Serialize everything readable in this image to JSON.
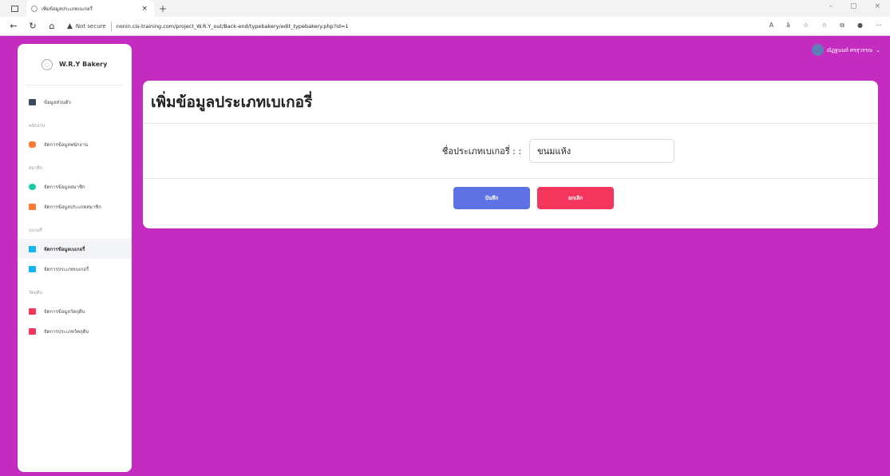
{
  "browser": {
    "tab_title": "เพิ่มข้อมูลประเภทเบเกอรี่",
    "tab_close": "×",
    "new_tab": "+",
    "not_secure": "Not secure",
    "url": "nonin.cis-training.com/project_W.R.Y_out/Back-end/typebakery/edit_typebakery.php?id=1",
    "window_controls": [
      "–",
      "▢",
      "×"
    ]
  },
  "sidebar": {
    "brand": "W.R.Y Bakery",
    "profile_item": "ข้อมูลส่วนตัว",
    "sections": [
      {
        "title": "พนักงาน",
        "items": [
          {
            "label": "จัดการข้อมูลพนักงาน",
            "icon": "user-icon",
            "color": "#ff7a35"
          }
        ]
      },
      {
        "title": "สมาชิก",
        "items": [
          {
            "label": "จัดการข้อมูลสมาชิก",
            "icon": "users-icon",
            "color": "#1bc9a5"
          },
          {
            "label": "จัดการข้อมูลประเภทสมาชิก",
            "icon": "book-icon",
            "color": "#ff7a35"
          }
        ]
      },
      {
        "title": "เบเกอรี่",
        "items": [
          {
            "label": "จัดการข้อมูลเบเกอรี่",
            "icon": "cake-icon",
            "color": "#11b5ef"
          },
          {
            "label": "จัดการประเภทเบเกอรี่",
            "icon": "book-icon",
            "color": "#11b5ef"
          }
        ]
      },
      {
        "title": "วัตถุดิบ",
        "items": [
          {
            "label": "จัดการข้อมูลวัตถุดิบ",
            "icon": "box-icon",
            "color": "#f5365c"
          },
          {
            "label": "จัดการประเภทวัตถุดิบ",
            "icon": "book-icon",
            "color": "#f5365c"
          }
        ]
      }
    ]
  },
  "header": {
    "user_name": "ณัฏฐนนท์ ศรสุวรรณ"
  },
  "form": {
    "title": "เพิ่มข้อมูลประเภทเบเกอรี่",
    "label": "ชื่อประเภทเบเกอรี่ : :",
    "value": "ขนมแห้ง",
    "save_label": "บันทึก",
    "cancel_label": "ยกเลิก"
  }
}
